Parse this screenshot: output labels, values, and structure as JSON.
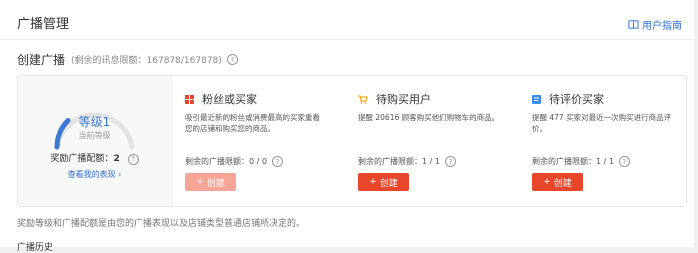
{
  "header": {
    "title": "广播管理",
    "help_label": "用户指南",
    "help_icon": "book-icon"
  },
  "section": {
    "title": "创建广播",
    "subtitle": "(剩余的讯息限额：167878/167878)"
  },
  "level": {
    "label": "等级1",
    "sub": "当前等级",
    "reward_label": "奖励广播配额：",
    "reward_value": "2",
    "view_link": "查看我的表现",
    "progress": 0.25,
    "accent": "#3a78d6"
  },
  "columns": [
    {
      "title": "粉丝或买家",
      "icon": "grid-icon",
      "icon_color": "#e8472b",
      "desc_line1": "吸引最近新的粉丝或消费最高的买家重看",
      "desc_line2": "您的店铺和购买您的商品。",
      "remain_label": "剩余的广播限额：",
      "remain_value": "0 / 0",
      "button_label": "创建",
      "button_state": "disabled"
    },
    {
      "title": "待购买用户",
      "icon": "cart-icon",
      "icon_color": "#f5a623",
      "desc_line1": "提醒 20616 顾客购买他们购物车的商品。",
      "desc_line2": "",
      "remain_label": "剩余的广播限额：",
      "remain_value": "1 / 1",
      "button_label": "创建",
      "button_state": "active"
    },
    {
      "title": "待评价买家",
      "icon": "review-icon",
      "icon_color": "#3a8ee6",
      "desc_line1": "提醒 477 买家对最近一次购买进行商品评",
      "desc_line2": "价。",
      "remain_label": "剩余的广播限额：",
      "remain_value": "1 / 1",
      "button_label": "创建",
      "button_state": "active"
    }
  ],
  "footer_note": "奖励等级和广播配额是由您的广播表现以及店铺类型普通店铺所决定的。",
  "bottom_cut_text": "广播历史"
}
